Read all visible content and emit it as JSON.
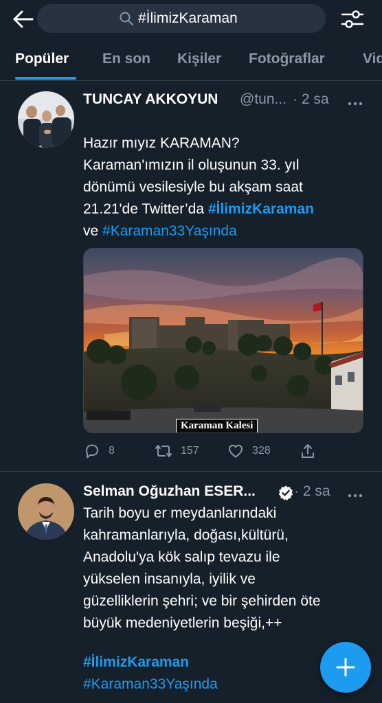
{
  "search": {
    "query": "#İlimizKaraman"
  },
  "tabs": [
    {
      "label": "Popüler",
      "active": true
    },
    {
      "label": "En son"
    },
    {
      "label": "Kişiler"
    },
    {
      "label": "Fotoğraflar"
    },
    {
      "label": "Vid"
    }
  ],
  "tweets": [
    {
      "author": "TUNCAY AKKOYUN",
      "handle": "@tun...",
      "time": "· 2 sa",
      "text_line1": "Hazır mıyız KARAMAN?",
      "text_para": "Karaman'ımızın il oluşunun 33. yıl\ndönümü vesilesiyle bu akşam saat\n21.21'de  Twitter’da ",
      "hashtag1": "#İlimizKaraman",
      "joiner": "ve ",
      "hashtag2": "#Karaman33Yaşında",
      "image_caption": "Karaman Kalesi",
      "replies": "8",
      "retweets": "157",
      "likes": "328"
    },
    {
      "author": "Selman Oğuzhan ESER...",
      "time": "· 2 sa",
      "verified": true,
      "text": "Tarih boyu er meydanlarındaki\nkahramanlarıyla, doğası,kültürü,\nAnadolu'ya kök salıp tevazu ile\nyükselen insanıyla, iyilik ve\ngüzelliklerin şehri; ve bir şehirden öte\nbüyük medeniyetlerin beşiği,++",
      "hashtag1": "#İlimizKaraman",
      "hashtag2": "#Karaman33Yaşında"
    }
  ],
  "colors": {
    "background": "#15202b",
    "accent": "#1d9bf0",
    "muted": "#8b98a5",
    "divider": "#38444d"
  },
  "icons": [
    "back-arrow-icon",
    "search-icon",
    "filter-icon",
    "more-icon",
    "reply-icon",
    "retweet-icon",
    "like-icon",
    "share-icon",
    "verified-icon",
    "compose-plus-icon"
  ]
}
